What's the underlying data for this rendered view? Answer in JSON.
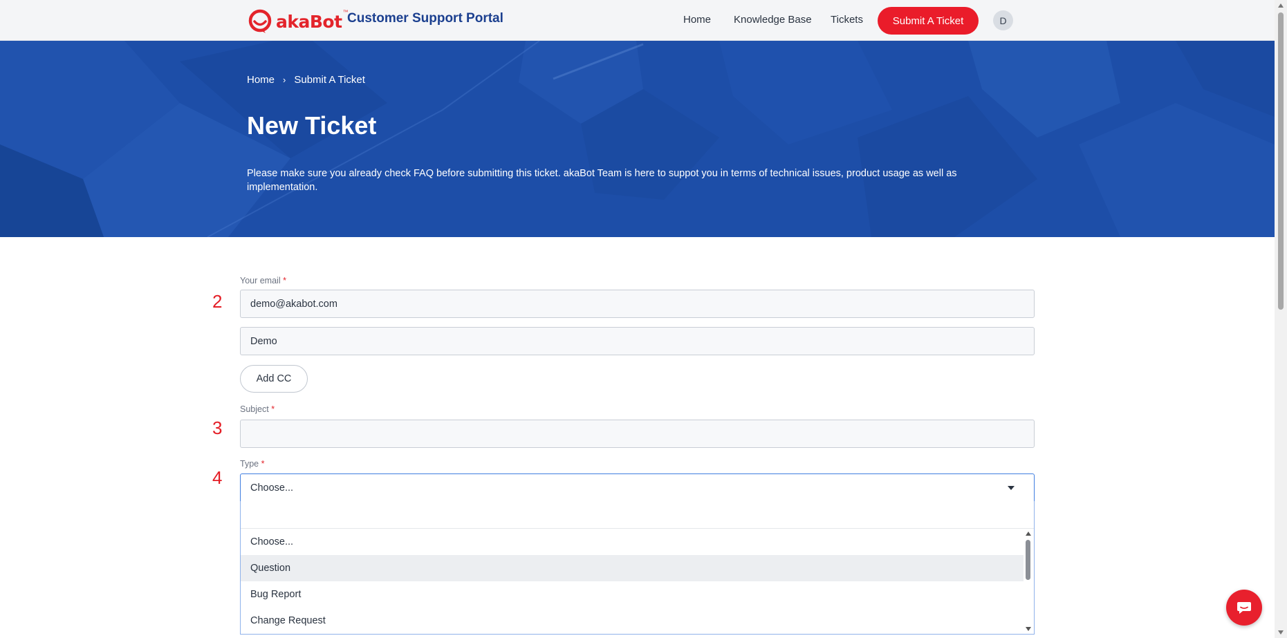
{
  "header": {
    "logo_text": "akaBot",
    "logo_tm": "™",
    "portal_title": "Customer Support Portal",
    "nav": [
      {
        "label": "Home"
      },
      {
        "label": "Knowledge Base"
      },
      {
        "label": "Tickets"
      }
    ],
    "submit_label": "Submit A Ticket",
    "avatar_initial": "D"
  },
  "hero": {
    "breadcrumb": [
      {
        "label": "Home"
      },
      {
        "label": "Submit A Ticket"
      }
    ],
    "breadcrumb_separator": "›",
    "title": "New Ticket",
    "intro": "Please make sure you already check FAQ before submitting this ticket. akaBot Team is here to suppot you in terms of technical issues, product usage as well as implementation."
  },
  "form": {
    "email": {
      "step": "2",
      "label": "Your email",
      "required": "*",
      "value": "demo@akabot.com"
    },
    "name": {
      "value": "Demo"
    },
    "add_cc_label": "Add CC",
    "subject": {
      "step": "3",
      "label": "Subject",
      "required": "*",
      "value": ""
    },
    "type": {
      "step": "4",
      "label": "Type",
      "required": "*",
      "selected": "Choose...",
      "search_value": "",
      "options": [
        {
          "label": "Choose..."
        },
        {
          "label": "Question",
          "highlighted": true
        },
        {
          "label": "Bug Report"
        },
        {
          "label": "Change Request"
        }
      ]
    }
  },
  "colors": {
    "brand_red": "#ea1c2a",
    "brand_blue": "#1b3f8f",
    "hero_blue": "#1d4ea8",
    "focus_blue": "#3f7de0"
  }
}
